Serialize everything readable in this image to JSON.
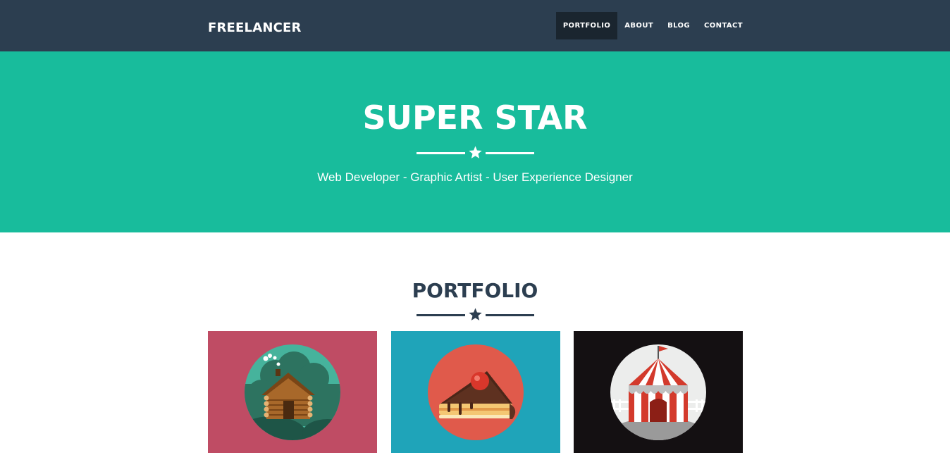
{
  "brand": "FREELANCER",
  "nav": {
    "items": [
      {
        "label": "PORTFOLIO",
        "active": true
      },
      {
        "label": "ABOUT",
        "active": false
      },
      {
        "label": "BLOG",
        "active": false
      },
      {
        "label": "CONTACT",
        "active": false
      }
    ]
  },
  "hero": {
    "title": "SUPER STAR",
    "subtitle": "Web Developer - Graphic Artist - User Experience Designer"
  },
  "portfolio": {
    "title": "PORTFOLIO",
    "items": [
      {
        "icon": "cabin-icon",
        "bg": "#bf4c64"
      },
      {
        "icon": "cake-icon",
        "bg": "#1fa4b9"
      },
      {
        "icon": "circus-tent-icon",
        "bg": "#141012"
      }
    ]
  },
  "colors": {
    "navbar": "#2c3e50",
    "nav_active": "#1a252f",
    "hero": "#18bc9c",
    "heading": "#2c3e50"
  }
}
